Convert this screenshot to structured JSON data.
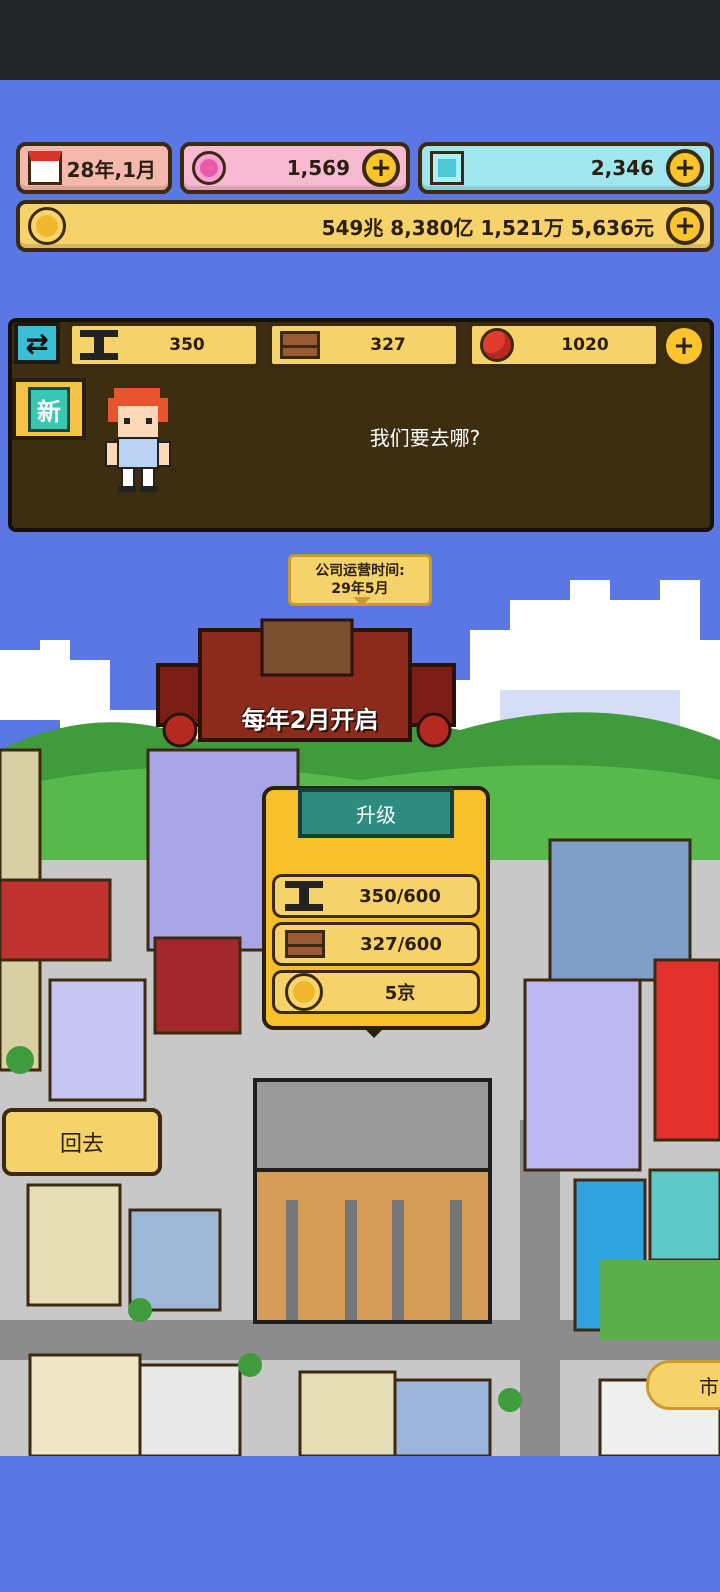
{
  "hud": {
    "date": "28年,1月",
    "gems": "1,569",
    "crystals": "2,346",
    "money": "549兆 8,380亿 1,521万 5,636元",
    "plus_label": "+"
  },
  "resources": {
    "swap_label": "⇄",
    "steel": "350",
    "brick": "327",
    "apple": "1020"
  },
  "dialog": {
    "new_badge": "新",
    "message": "我们要去哪?"
  },
  "scene": {
    "tooltip_line1": "公司运营时间:",
    "tooltip_line2": "29年5月",
    "banner": "每年2月开启"
  },
  "upgrade": {
    "button_label": "升级",
    "steel_req": "350/600",
    "brick_req": "327/600",
    "cost": "5京"
  },
  "nav": {
    "back": "回去",
    "market": "市"
  },
  "colors": {
    "background": "#5b77e3",
    "gold": "#f6d26b",
    "panel": "#3d2e11",
    "teal": "#2e8b80"
  }
}
